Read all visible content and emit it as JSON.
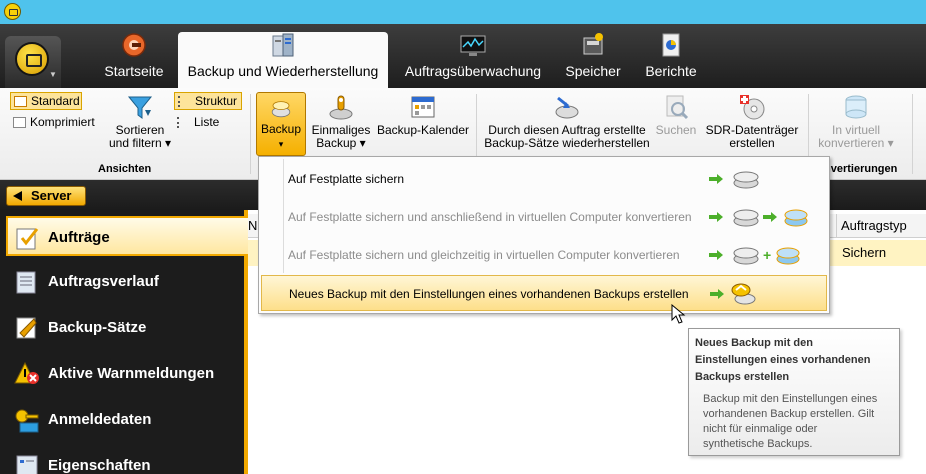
{
  "header": {
    "tabs": [
      {
        "label": "Startseite",
        "icon": "home-gear-icon",
        "active": false
      },
      {
        "label": "Backup und Wiederherstellung",
        "icon": "backup-server-icon",
        "active": true
      },
      {
        "label": "Auftragsüberwachung",
        "icon": "monitor-icon",
        "active": false
      },
      {
        "label": "Speicher",
        "icon": "storage-icon",
        "active": false
      },
      {
        "label": "Berichte",
        "icon": "reports-icon",
        "active": false
      }
    ]
  },
  "ribbon": {
    "ansichten": {
      "standard": "Standard",
      "komprimiert": "Komprimiert",
      "sortieren_line1": "Sortieren",
      "sortieren_line2": "und filtern ▾",
      "struktur": "Struktur",
      "liste": "Liste",
      "group_label": "Ansichten"
    },
    "backup": "Backup",
    "backup_caret": "▾",
    "einmaliges_line1": "Einmaliges",
    "einmaliges_line2": "Backup ▾",
    "kalender": "Backup-Kalender",
    "durch_line1": "Durch diesen Auftrag erstellte",
    "durch_line2": "Backup-Sätze wiederherstellen",
    "suchen": "Suchen",
    "sdr_line1": "SDR-Datenträger",
    "sdr_line2": "erstellen",
    "virtuell_line1": "In virtuell",
    "virtuell_line2": "konvertieren ▾",
    "konv_group_label": "nvertierungen"
  },
  "server_button": "Server",
  "nav": {
    "items": [
      {
        "label": "Aufträge",
        "icon": "jobs-icon",
        "active": true
      },
      {
        "label": "Auftragsverlauf",
        "icon": "history-icon",
        "active": false
      },
      {
        "label": "Backup-Sätze",
        "icon": "backup-sets-icon",
        "active": false
      },
      {
        "label": "Aktive Warnmeldungen",
        "icon": "alert-icon",
        "active": false
      },
      {
        "label": "Anmeldedaten",
        "icon": "credentials-icon",
        "active": false
      },
      {
        "label": "Eigenschaften",
        "icon": "properties-icon",
        "active": false
      }
    ]
  },
  "grid": {
    "col_n": "N",
    "col_type": "Auftragstyp",
    "row_type": "Sichern"
  },
  "menu": {
    "items": [
      {
        "label": "Auf Festplatte sichern",
        "enabled": true
      },
      {
        "label": "Auf Festplatte sichern und anschließend in virtuellen Computer konvertieren",
        "enabled": false
      },
      {
        "label": "Auf Festplatte sichern und gleichzeitig in virtuellen Computer konvertieren",
        "enabled": false
      },
      {
        "label": "Neues Backup mit den Einstellungen eines vorhandenen Backups erstellen",
        "enabled": true,
        "highlighted": true
      }
    ]
  },
  "tooltip": {
    "title_line1": "Neues Backup mit den",
    "title_line2": "Einstellungen eines vorhandenen",
    "title_line3": "Backups erstellen",
    "body_line1": "Backup mit den Einstellungen eines",
    "body_line2": "vorhandenen Backup erstellen.  Gilt",
    "body_line3": "nicht für einmalige oder",
    "body_line4": "synthetische Backups."
  },
  "colors": {
    "accent": "#f2a900",
    "titlebar": "#4fc3ec",
    "header_dark": "#1e1e1e",
    "selection": "#fddf8a",
    "green_arrow": "#4caf2a"
  }
}
